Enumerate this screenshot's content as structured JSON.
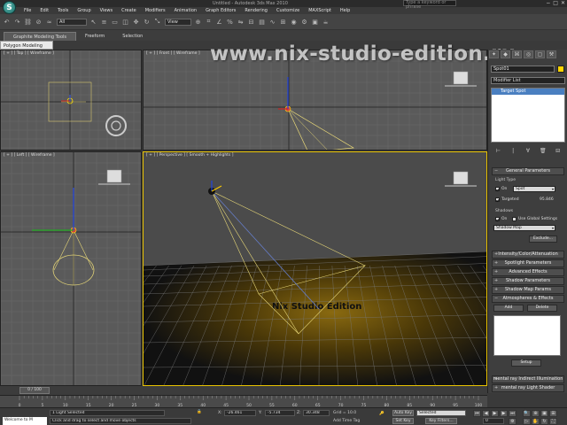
{
  "app": {
    "title": "Untitled - Autodesk 3ds Max 2010",
    "search_placeholder": "Type a keyword or phrase",
    "logo_glyph": "S"
  },
  "menu": [
    "File",
    "Edit",
    "Tools",
    "Group",
    "Views",
    "Create",
    "Modifiers",
    "Animation",
    "Graph Editors",
    "Rendering",
    "Customize",
    "MAXScript",
    "Help"
  ],
  "toolbar": {
    "selection_filter": "All",
    "ref_coord": "View"
  },
  "ribbon": {
    "tabs": [
      "Graphite Modeling Tools",
      "Freeform",
      "Selection"
    ],
    "sub_label": "Polygon Modeling"
  },
  "watermark": "www.nix-studio-edition.ru",
  "viewports": {
    "top": "[ + ] [ Top ] [ Wireframe ]",
    "front": "[ + ] [ Front ] [ Wireframe ]",
    "left": "[ + ] [ Left ] [ Wireframe ]",
    "perspective": "[ + ] [ Perspective ] [ Smooth + Highlights ]",
    "scene_text": "Nix Studio Edition"
  },
  "command_panel": {
    "object_name": "Spot01",
    "swatch_color": "#ffd400",
    "modifier_list": "Modifier List",
    "stack_item": "Target Spot",
    "general": {
      "title": "General Parameters",
      "light_type_label": "Light Type",
      "on_label": "On",
      "type_value": "Spot",
      "targeted_label": "Targeted",
      "target_distance": "95.846",
      "shadows_label": "Shadows",
      "shadows_on": "On",
      "use_global": "Use Global Settings",
      "shadow_type": "Shadow Map",
      "exclude_btn": "Exclude..."
    },
    "rollouts": [
      "Intensity/Color/Attenuation",
      "Spotlight Parameters",
      "Advanced Effects",
      "Shadow Parameters",
      "Shadow Map Params"
    ],
    "atmos": {
      "title": "Atmospheres & Effects",
      "add": "Add",
      "delete": "Delete",
      "setup": "Setup"
    },
    "mr_rollouts": [
      "mental ray Indirect Illumination",
      "mental ray Light Shader"
    ]
  },
  "timeline": {
    "slider": "0 / 100",
    "ticks": [
      "0",
      "5",
      "10",
      "15",
      "20",
      "25",
      "30",
      "35",
      "40",
      "45",
      "50",
      "55",
      "60",
      "65",
      "70",
      "75",
      "80",
      "85",
      "90",
      "95",
      "100"
    ]
  },
  "status": {
    "maxscript": "Welcome to M",
    "selection_msg": "1 Light Selected",
    "prompt": "Click and drag to select and move objects",
    "x_label": "X:",
    "x_val": "-26.461",
    "y_label": "Y:",
    "y_val": "-5.734",
    "z_label": "Z:",
    "z_val": "30.348",
    "grid": "Grid = 10.0",
    "auto_key": "Auto Key",
    "selected": "Selected",
    "set_key": "Set Key",
    "key_filters": "Key Filters...",
    "add_time_tag": "Add Time Tag",
    "frame": "0"
  }
}
